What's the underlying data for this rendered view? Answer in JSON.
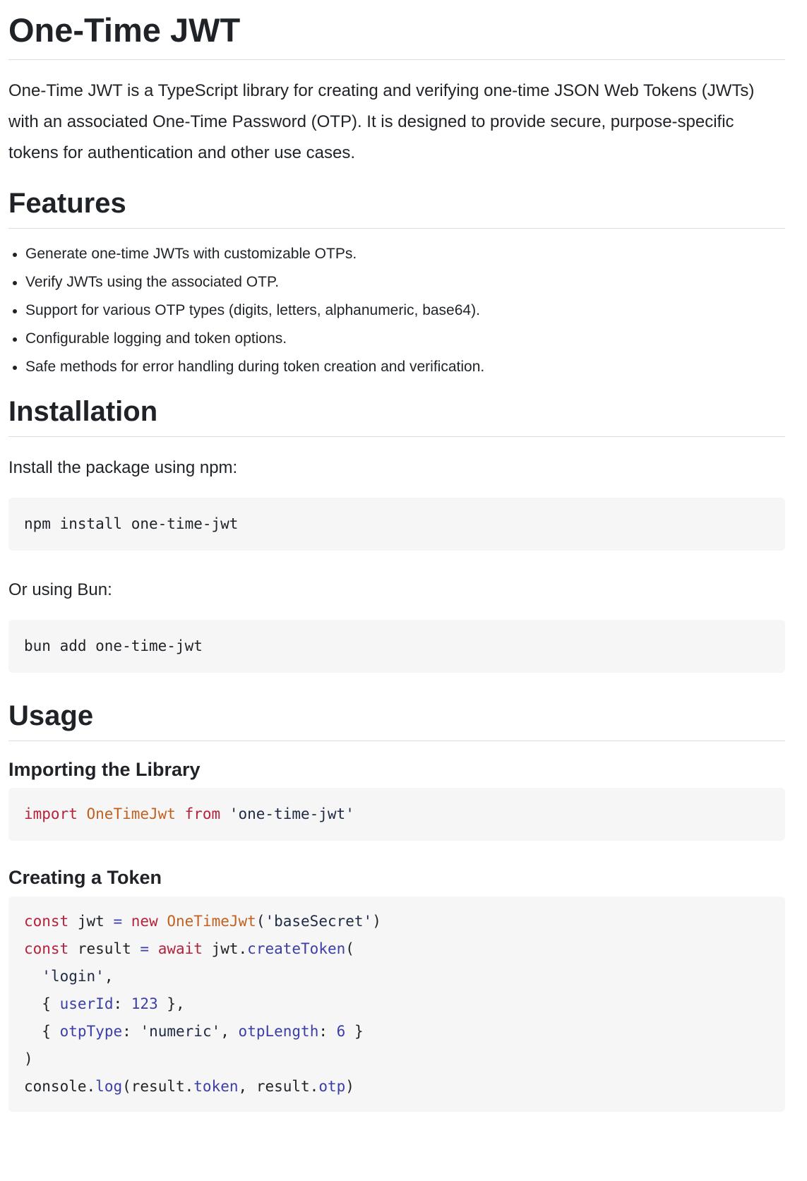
{
  "title": "One-Time JWT",
  "intro": "One-Time JWT is a TypeScript library for creating and verifying one-time JSON Web Tokens (JWTs) with an associated One-Time Password (OTP). It is designed to provide secure, purpose-specific tokens for authentication and other use cases.",
  "features": {
    "heading": "Features",
    "items": [
      "Generate one-time JWTs with customizable OTPs.",
      "Verify JWTs using the associated OTP.",
      "Support for various OTP types (digits, letters, alphanumeric, base64).",
      "Configurable logging and token options.",
      "Safe methods for error handling during token creation and verification."
    ]
  },
  "installation": {
    "heading": "Installation",
    "npm_text": "Install the package using npm:",
    "npm_cmd": "npm install one-time-jwt",
    "bun_text": "Or using Bun:",
    "bun_cmd": "bun add one-time-jwt"
  },
  "usage": {
    "heading": "Usage",
    "import_heading": "Importing the Library",
    "import_code": {
      "kw_import": "import",
      "cls": "OneTimeJwt",
      "kw_from": "from",
      "str": "'one-time-jwt'"
    },
    "create_heading": "Creating a Token",
    "create_code": {
      "const1": "const",
      "jwt": "jwt",
      "eq1": "=",
      "new": "new",
      "cls": "OneTimeJwt",
      "paren_open1": "(",
      "base_secret": "'baseSecret'",
      "paren_close1": ")",
      "const2": "const",
      "result": "result",
      "eq2": "=",
      "await": "await",
      "jwt_ref": "jwt",
      "dot1": ".",
      "create_token": "createToken",
      "paren_open2": "(",
      "login": "'login'",
      "comma1": ",",
      "brace_open1": "{",
      "user_id_key": "userId",
      "colon1": ":",
      "user_id_val": "123",
      "brace_close1": "},",
      "brace_open2": "{",
      "otp_type_key": "otpType",
      "colon2": ":",
      "otp_type_val": "'numeric'",
      "comma2": ",",
      "otp_length_key": "otpLength",
      "colon3": ":",
      "otp_length_val": "6",
      "brace_close2": "}",
      "paren_close2": ")",
      "console": "console",
      "dot2": ".",
      "log": "log",
      "paren_open3": "(",
      "result_ref1": "result",
      "dot3": ".",
      "token": "token",
      "comma3": ",",
      "result_ref2": "result",
      "dot4": ".",
      "otp": "otp",
      "paren_close3": ")"
    }
  }
}
